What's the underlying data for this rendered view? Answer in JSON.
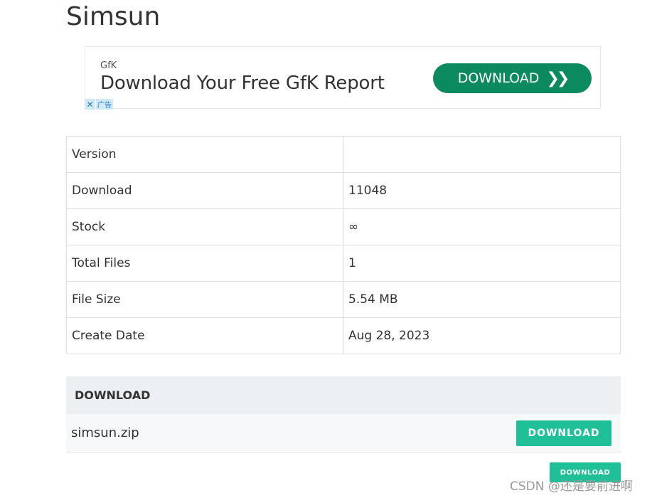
{
  "page": {
    "title": "Simsun"
  },
  "ad": {
    "brand": "GfK",
    "headline": "Download Your Free GfK Report",
    "cta_label": "DOWNLOAD",
    "cta_icon": "double-chevron-right-icon",
    "close_icon": "close-icon",
    "badge_label": "广告",
    "colors": {
      "cta": "#0a8a5e"
    }
  },
  "info_table": {
    "rows": [
      {
        "label": "Version",
        "value": ""
      },
      {
        "label": "Download",
        "value": "11048"
      },
      {
        "label": "Stock",
        "value": "∞"
      },
      {
        "label": "Total Files",
        "value": "1"
      },
      {
        "label": "File Size",
        "value": "5.54 MB"
      },
      {
        "label": "Create Date",
        "value": "Aug 28, 2023"
      }
    ]
  },
  "download_section": {
    "header": "DOWNLOAD",
    "files": [
      {
        "name": "simsun.zip",
        "button_label": "DOWNLOAD"
      }
    ],
    "bottom_button_label": "DOWNLOAD",
    "colors": {
      "button": "#1fbf97"
    }
  },
  "watermark": {
    "text": "CSDN @还是要前进啊"
  }
}
